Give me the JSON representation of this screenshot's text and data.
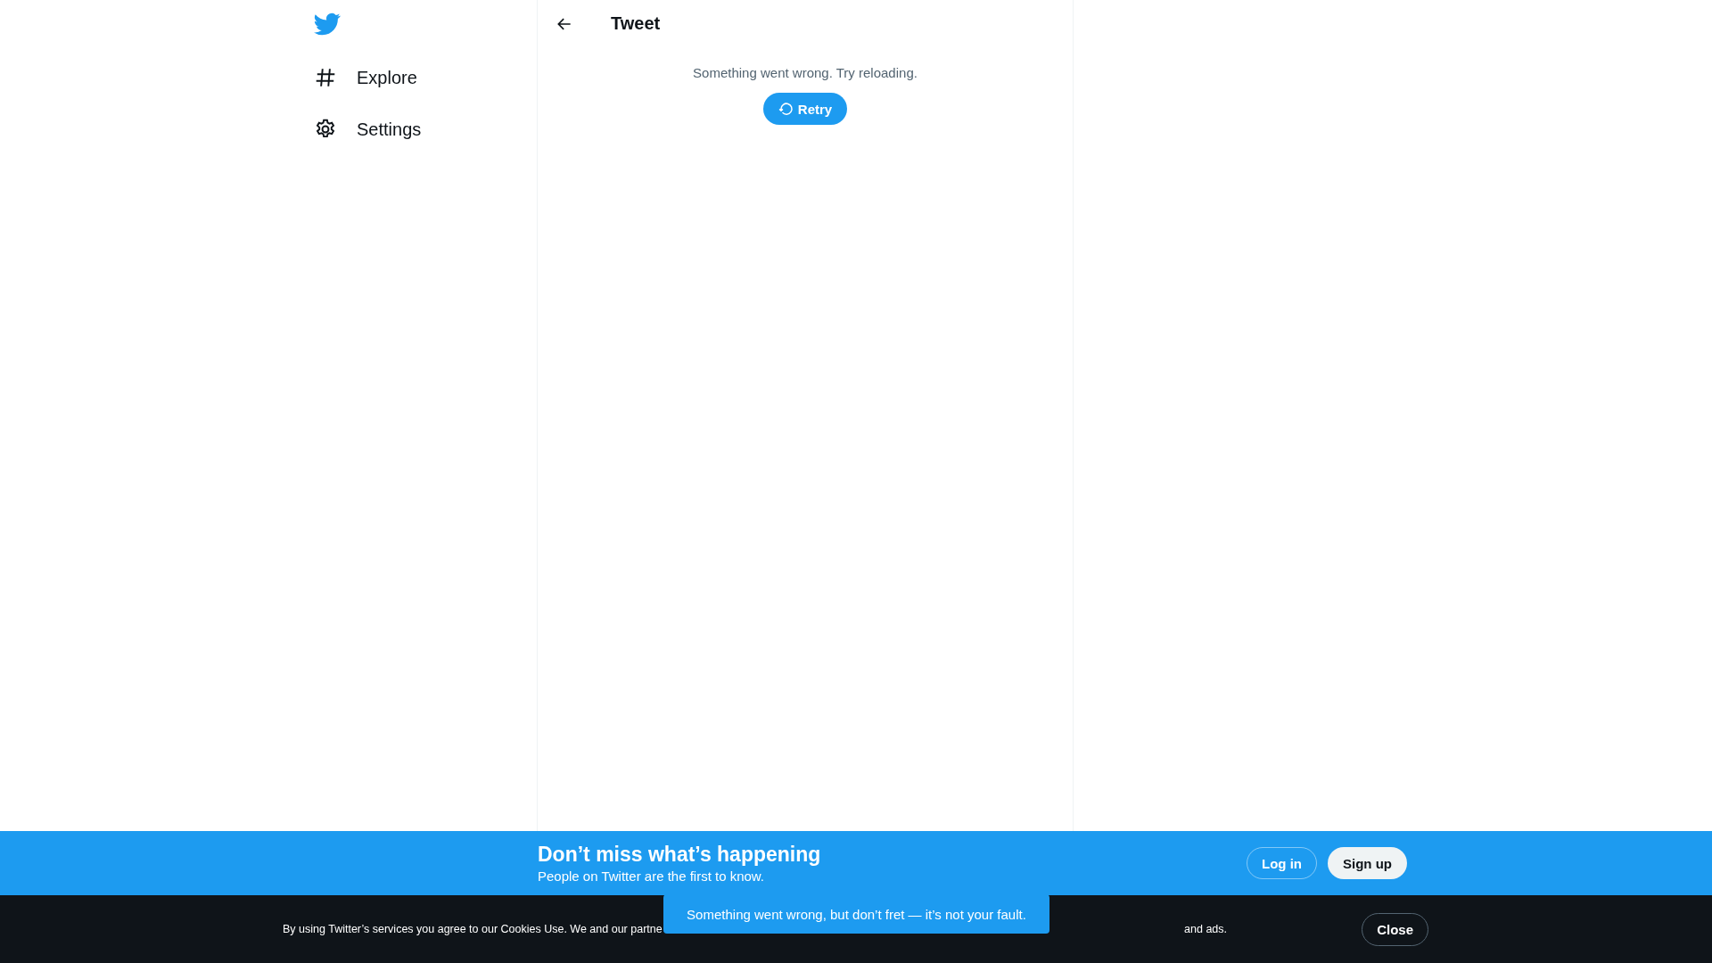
{
  "sidebar": {
    "items": [
      {
        "label": "Explore"
      },
      {
        "label": "Settings"
      }
    ]
  },
  "main": {
    "title": "Tweet",
    "error": "Something went wrong. Try reloading.",
    "retry_button": "Retry"
  },
  "signup_bar": {
    "title": "Don’t miss what’s happening",
    "subtitle": "People on Twitter are the first to know.",
    "buttons": [
      "Log in",
      "Sign up"
    ]
  },
  "cookie_bar": {
    "text_start": "By using Twitter’s services you agree to our Cookies Use. We and our partne",
    "text_end": "and ads.",
    "close_button": "Close"
  },
  "toast": {
    "message": "Something went wrong, but don’t fret — it’s not your fault."
  }
}
